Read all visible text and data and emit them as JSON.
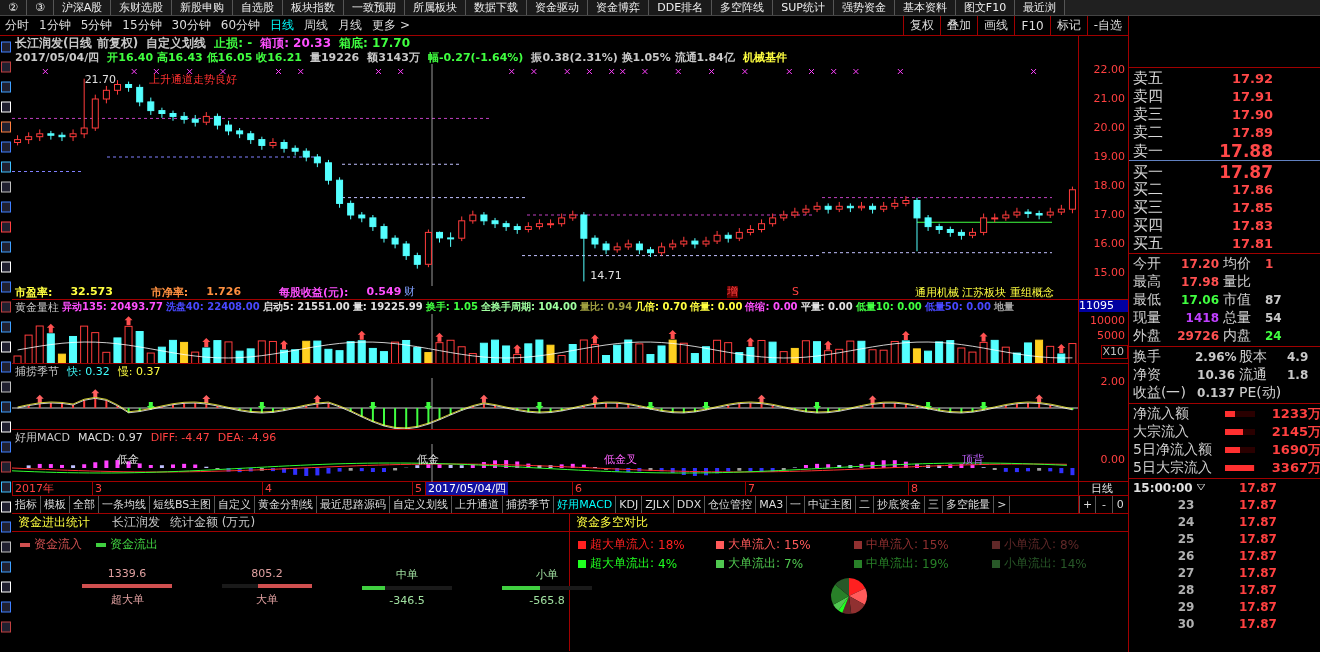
{
  "top_menu": [
    "②",
    "③",
    "沪深A股",
    "东财选股",
    "新股申购",
    "自选股",
    "板块指数",
    "一致预期",
    "所属板块",
    "数据下载",
    "资金驱动",
    "资金博弈",
    "DDE排名",
    "多空阵线",
    "SUP统计",
    "强势资金",
    "基本资料",
    "图文F10",
    "最近浏"
  ],
  "period_tabs": [
    {
      "label": "分时",
      "selected": false
    },
    {
      "label": "1分钟",
      "selected": false
    },
    {
      "label": "5分钟",
      "selected": false
    },
    {
      "label": "15分钟",
      "selected": false
    },
    {
      "label": "30分钟",
      "selected": false
    },
    {
      "label": "60分钟",
      "selected": false
    },
    {
      "label": "日线",
      "selected": true
    },
    {
      "label": "周线",
      "selected": false
    },
    {
      "label": "月线",
      "selected": false
    },
    {
      "label": "更多 >",
      "selected": false
    }
  ],
  "chart_tools": [
    "复权",
    "叠加",
    "画线",
    "F10",
    "标记",
    "-自选"
  ],
  "price_panel": {
    "header": [
      {
        "text": "长江润发(日线 前复权)",
        "color": "#c8c8c8"
      },
      {
        "text": "自定义划线",
        "color": "#c8c8c8"
      },
      {
        "text": "止损: -",
        "color": "#40ff40"
      },
      {
        "text": "箱顶: 20.33",
        "color": "#ff50ff"
      },
      {
        "text": "箱底: 17.70",
        "color": "#40ff40"
      }
    ],
    "quote": [
      {
        "text": "2017/05/04/四",
        "color": "#c8c8c8"
      },
      {
        "text": "开16.40 高16.43 低16.05 收16.21",
        "color": "#40ff40"
      },
      {
        "text": "量19226",
        "color": "#c8c8c8"
      },
      {
        "text": "额3143万",
        "color": "#c8c8c8"
      },
      {
        "text": "幅-0.27(-1.64%)",
        "color": "#40ff40"
      },
      {
        "text": "振0.38(2.31%) 换1.05% 流通1.84亿",
        "color": "#c8c8c8"
      },
      {
        "text": "机械基件",
        "color": "#ffff40"
      }
    ],
    "axis": [
      "22.00",
      "21.00",
      "20.00",
      "19.00",
      "18.00",
      "17.00",
      "16.00",
      "15.00"
    ],
    "annotations": [
      "21.70",
      "上升通道走势良好",
      "14.71"
    ],
    "valuation": [
      {
        "label": "市盈率:",
        "value": "32.573",
        "color": "#ffff40"
      },
      {
        "label": "市净率:",
        "value": "1.726",
        "color": "#ff9040"
      },
      {
        "label": "每股收益(元):",
        "value": "0.549",
        "color": "#ff50ff"
      }
    ],
    "event_marks": [
      "财",
      "增",
      "S"
    ],
    "concepts": "通用机械 江苏板块 重组概念",
    "chart_data": {
      "type": "candlestick",
      "ohlc": [
        [
          19.5,
          19.75,
          19.4,
          19.6
        ],
        [
          19.6,
          19.85,
          19.45,
          19.7
        ],
        [
          19.7,
          19.95,
          19.55,
          19.8
        ],
        [
          19.8,
          19.9,
          19.6,
          19.75
        ],
        [
          19.75,
          19.85,
          19.55,
          19.7
        ],
        [
          19.7,
          19.95,
          19.55,
          19.8
        ],
        [
          19.8,
          21.7,
          19.65,
          20.0
        ],
        [
          20.0,
          21.15,
          19.9,
          21.0
        ],
        [
          21.0,
          21.45,
          20.85,
          21.3
        ],
        [
          21.3,
          21.65,
          21.15,
          21.5
        ],
        [
          21.5,
          21.6,
          21.25,
          21.4
        ],
        [
          21.4,
          21.5,
          20.75,
          20.9
        ],
        [
          20.9,
          21.05,
          20.45,
          20.6
        ],
        [
          20.6,
          20.7,
          20.35,
          20.5
        ],
        [
          20.5,
          20.6,
          20.25,
          20.4
        ],
        [
          20.4,
          20.55,
          20.15,
          20.3
        ],
        [
          20.3,
          20.45,
          20.05,
          20.2
        ],
        [
          20.2,
          20.55,
          20.1,
          20.4
        ],
        [
          20.4,
          20.5,
          19.95,
          20.1
        ],
        [
          20.1,
          20.25,
          19.75,
          19.9
        ],
        [
          19.9,
          20.0,
          19.65,
          19.8
        ],
        [
          19.8,
          19.9,
          19.45,
          19.6
        ],
        [
          19.6,
          19.7,
          19.25,
          19.4
        ],
        [
          19.4,
          19.65,
          19.3,
          19.5
        ],
        [
          19.5,
          19.6,
          19.15,
          19.3
        ],
        [
          19.3,
          19.4,
          19.05,
          19.2
        ],
        [
          19.2,
          19.3,
          18.85,
          19.0
        ],
        [
          19.0,
          19.1,
          18.65,
          18.8
        ],
        [
          18.8,
          18.9,
          18.05,
          18.2
        ],
        [
          18.2,
          18.3,
          17.25,
          17.4
        ],
        [
          17.4,
          17.5,
          16.85,
          17.0
        ],
        [
          17.0,
          17.1,
          16.75,
          16.9
        ],
        [
          16.9,
          17.0,
          16.45,
          16.6
        ],
        [
          16.6,
          16.7,
          16.05,
          16.2
        ],
        [
          16.2,
          16.3,
          15.85,
          16.0
        ],
        [
          16.0,
          16.1,
          15.45,
          15.6
        ],
        [
          15.6,
          15.7,
          15.15,
          15.3
        ],
        [
          15.3,
          16.5,
          15.2,
          16.4
        ],
        [
          16.4,
          16.43,
          16.05,
          16.21
        ],
        [
          16.21,
          16.4,
          15.9,
          16.2
        ],
        [
          16.2,
          16.95,
          16.1,
          16.8
        ],
        [
          16.8,
          17.15,
          16.7,
          17.0
        ],
        [
          17.0,
          17.1,
          16.65,
          16.8
        ],
        [
          16.8,
          16.9,
          16.55,
          16.7
        ],
        [
          16.7,
          16.8,
          16.45,
          16.6
        ],
        [
          16.6,
          16.7,
          16.35,
          16.5
        ],
        [
          16.5,
          16.75,
          16.4,
          16.6
        ],
        [
          16.6,
          16.85,
          16.5,
          16.7
        ],
        [
          16.7,
          16.85,
          16.55,
          16.7
        ],
        [
          16.7,
          17.05,
          16.6,
          16.9
        ],
        [
          16.9,
          17.15,
          16.8,
          17.0
        ],
        [
          17.0,
          17.1,
          14.71,
          16.2
        ],
        [
          16.2,
          16.3,
          15.85,
          16.0
        ],
        [
          16.0,
          16.1,
          15.65,
          15.8
        ],
        [
          15.8,
          16.05,
          15.7,
          15.9
        ],
        [
          15.9,
          16.15,
          15.8,
          16.0
        ],
        [
          16.0,
          16.1,
          15.65,
          15.8
        ],
        [
          15.8,
          15.9,
          15.55,
          15.7
        ],
        [
          15.7,
          16.05,
          15.6,
          15.9
        ],
        [
          15.9,
          16.15,
          15.8,
          16.0
        ],
        [
          16.0,
          16.25,
          15.9,
          16.1
        ],
        [
          16.1,
          16.2,
          15.85,
          16.0
        ],
        [
          16.0,
          16.25,
          15.9,
          16.1
        ],
        [
          16.1,
          16.45,
          16.0,
          16.3
        ],
        [
          16.3,
          16.4,
          16.05,
          16.2
        ],
        [
          16.2,
          16.55,
          16.1,
          16.4
        ],
        [
          16.4,
          16.65,
          16.3,
          16.5
        ],
        [
          16.5,
          16.85,
          16.4,
          16.7
        ],
        [
          16.7,
          17.05,
          16.6,
          16.9
        ],
        [
          16.9,
          17.15,
          16.8,
          17.0
        ],
        [
          17.0,
          17.25,
          16.9,
          17.1
        ],
        [
          17.1,
          17.35,
          17.0,
          17.2
        ],
        [
          17.2,
          17.45,
          17.1,
          17.3
        ],
        [
          17.3,
          17.4,
          17.05,
          17.2
        ],
        [
          17.2,
          17.45,
          17.1,
          17.3
        ],
        [
          17.3,
          17.4,
          17.1,
          17.25
        ],
        [
          17.25,
          17.45,
          17.15,
          17.3
        ],
        [
          17.3,
          17.4,
          17.05,
          17.2
        ],
        [
          17.2,
          17.45,
          17.1,
          17.3
        ],
        [
          17.3,
          17.55,
          17.2,
          17.4
        ],
        [
          17.4,
          17.65,
          17.3,
          17.5
        ],
        [
          17.5,
          17.6,
          15.75,
          16.9
        ],
        [
          16.9,
          17.0,
          16.45,
          16.6
        ],
        [
          16.6,
          16.7,
          16.35,
          16.5
        ],
        [
          16.5,
          16.6,
          16.25,
          16.4
        ],
        [
          16.4,
          16.5,
          16.15,
          16.3
        ],
        [
          16.3,
          16.55,
          16.2,
          16.4
        ],
        [
          16.4,
          17.05,
          16.3,
          16.9
        ],
        [
          16.9,
          17.05,
          16.75,
          16.9
        ],
        [
          16.9,
          17.15,
          16.8,
          17.0
        ],
        [
          17.0,
          17.25,
          16.9,
          17.1
        ],
        [
          17.1,
          17.2,
          16.9,
          17.05
        ],
        [
          17.05,
          17.15,
          16.85,
          17.0
        ],
        [
          17.0,
          17.25,
          16.9,
          17.1
        ],
        [
          17.1,
          17.35,
          17.0,
          17.2
        ],
        [
          17.2,
          17.98,
          17.06,
          17.87
        ]
      ]
    }
  },
  "volume_panel": {
    "title": "黄金量柱",
    "values": [
      {
        "text": "异动135: 20493.77",
        "color": "#ff50ff"
      },
      {
        "text": "洗盘40: 22408.00",
        "color": "#4848ff"
      },
      {
        "text": "启动5: 21551.00",
        "color": "#e0e0e0"
      },
      {
        "text": "量: 19225.99",
        "color": "#e0e0e0"
      },
      {
        "text": "换手: 1.05",
        "color": "#40ff40"
      },
      {
        "text": "全换手周期: 104.00",
        "color": "#a0ffa0"
      },
      {
        "text": "量比: 0.94",
        "color": "#a0a040"
      },
      {
        "text": "几倍: 0.70",
        "color": "#ffff40"
      },
      {
        "text": "倍量: 0.00",
        "color": "#ffff40"
      },
      {
        "text": "倍缩: 0.00",
        "color": "#ff50ff"
      },
      {
        "text": "平量: 0.00",
        "color": "#e0e0e0"
      },
      {
        "text": "低量10: 0.00",
        "color": "#40ff40"
      },
      {
        "text": "低量50: 0.00",
        "color": "#4848ff"
      },
      {
        "text": "地量",
        "color": "#a0a0a0"
      }
    ],
    "axis": [
      "11095",
      "10000",
      "5000",
      "X10"
    ]
  },
  "capture_panel": {
    "title": "捕捞季节",
    "values": [
      {
        "text": "快: 0.32",
        "color": "#40ffff"
      },
      {
        "text": "慢: 0.37",
        "color": "#ffff40"
      }
    ],
    "axis": [
      "2.00"
    ]
  },
  "macd_panel": {
    "title": "好用MACD",
    "values": [
      {
        "text": "MACD: 0.97",
        "color": "#e0e0e0"
      },
      {
        "text": "DIFF: -4.47",
        "color": "#ff4040"
      },
      {
        "text": "DEA: -4.96",
        "color": "#ff4040"
      }
    ],
    "signals": [
      "低金",
      "低金",
      "低金叉",
      "顶背"
    ],
    "axis": [
      "0.00"
    ]
  },
  "date_axis": {
    "labels": [
      "2017年",
      "3",
      "4",
      "5",
      "6",
      "7",
      "8"
    ],
    "cursor": "2017/05/04/四",
    "period": "日线"
  },
  "indicator_tabs": [
    {
      "label": "指标",
      "selected": false
    },
    {
      "label": "模板",
      "selected": false
    },
    {
      "label": "全部",
      "selected": false
    },
    {
      "label": "一条均线",
      "selected": false
    },
    {
      "label": "短线BS主图",
      "selected": false
    },
    {
      "label": "自定义",
      "selected": false
    },
    {
      "label": "黄金分割线",
      "selected": false
    },
    {
      "label": "最近思路源码",
      "selected": false
    },
    {
      "label": "自定义划线",
      "selected": false
    },
    {
      "label": "上升通道",
      "selected": false
    },
    {
      "label": "捕捞季节",
      "selected": false
    },
    {
      "label": "好用MACD",
      "selected": true
    },
    {
      "label": "KDJ",
      "selected": false
    },
    {
      "label": "ZJLX",
      "selected": false
    },
    {
      "label": "DDX",
      "selected": false
    },
    {
      "label": "仓位管控",
      "selected": false
    },
    {
      "label": "MA3",
      "selected": false
    },
    {
      "label": "一",
      "selected": false
    },
    {
      "label": "中证主图",
      "selected": false
    },
    {
      "label": "二",
      "selected": false
    },
    {
      "label": "抄底资金",
      "selected": false
    },
    {
      "label": "三",
      "selected": false
    },
    {
      "label": "多空能量",
      "selected": false
    },
    {
      "label": ">",
      "selected": false
    }
  ],
  "zoom_buttons": [
    "+",
    "-",
    "0"
  ],
  "fund_stats": {
    "title": "资金进出统计",
    "stock": "长江润发",
    "unit": "统计金额 (万元)",
    "legend": [
      {
        "label": "资金流入",
        "color": "#d05050"
      },
      {
        "label": "资金流出",
        "color": "#40d040"
      }
    ],
    "groups": [
      {
        "label": "超大单",
        "value": "1339.6",
        "kind": "inflow",
        "level": 1.0
      },
      {
        "label": "大单",
        "value": "805.2",
        "kind": "inflow",
        "level": 0.6
      },
      {
        "label": "中单",
        "value": "-346.5",
        "kind": "outflow",
        "level": 0.26
      },
      {
        "label": "小单",
        "value": "-565.8",
        "kind": "outflow",
        "level": 0.42
      }
    ]
  },
  "fund_compare": {
    "title": "资金多空对比",
    "items": [
      {
        "label": "超大单流入:",
        "value": "18%",
        "color": "#ff2020"
      },
      {
        "label": "大单流入:",
        "value": "15%",
        "color": "#ff5a5a"
      },
      {
        "label": "中单流入:",
        "value": "15%",
        "color": "#903030"
      },
      {
        "label": "小单流入:",
        "value": "8%",
        "color": "#602828"
      },
      {
        "label": "超大单流出:",
        "value": "4%",
        "color": "#20ff20"
      },
      {
        "label": "大单流出:",
        "value": "7%",
        "color": "#50c850"
      },
      {
        "label": "中单流出:",
        "value": "19%",
        "color": "#288028"
      },
      {
        "label": "小单流出:",
        "value": "14%",
        "color": "#285828"
      }
    ],
    "chart_data": {
      "type": "pie",
      "values": [
        18,
        15,
        15,
        8,
        4,
        7,
        19,
        14
      ]
    }
  },
  "quote_panel": {
    "sell": [
      {
        "label": "卖五",
        "price": "17.92",
        "large": false
      },
      {
        "label": "卖四",
        "price": "17.91",
        "large": false
      },
      {
        "label": "卖三",
        "price": "17.90",
        "large": false
      },
      {
        "label": "卖二",
        "price": "17.89",
        "large": false
      },
      {
        "label": "卖一",
        "price": "17.88",
        "large": true
      }
    ],
    "buy": [
      {
        "label": "买一",
        "price": "17.87",
        "large": true
      },
      {
        "label": "买二",
        "price": "17.86",
        "large": false
      },
      {
        "label": "买三",
        "price": "17.85",
        "large": false
      },
      {
        "label": "买四",
        "price": "17.83",
        "large": false
      },
      {
        "label": "买五",
        "price": "17.81",
        "large": false
      }
    ],
    "stats": [
      [
        {
          "label": "今开",
          "value": "17.20",
          "color": "#ff5050"
        },
        {
          "label": "均价",
          "value": "1",
          "color": "#ff5050"
        }
      ],
      [
        {
          "label": "最高",
          "value": "17.98",
          "color": "#ff5050"
        },
        {
          "label": "量比"
        }
      ],
      [
        {
          "label": "最低",
          "value": "17.06",
          "color": "#40ff40"
        },
        {
          "label": "市值",
          "value": "87",
          "color": "#c8c8c8"
        }
      ],
      [
        {
          "label": "现量",
          "value": "1418",
          "color": "#c040ff"
        },
        {
          "label": "总量",
          "value": "54",
          "color": "#c8c8c8"
        }
      ],
      [
        {
          "label": "外盘",
          "value": "29726",
          "color": "#ff5050"
        },
        {
          "label": "内盘",
          "value": "24",
          "color": "#40ff40"
        }
      ]
    ],
    "fundamentals": [
      [
        {
          "label": "换手",
          "value": "2.96%",
          "color": "#c8c8c8"
        },
        {
          "label": "股本",
          "value": "4.9",
          "color": "#c8c8c8"
        }
      ],
      [
        {
          "label": "净资",
          "value": "10.36",
          "color": "#c8c8c8"
        },
        {
          "label": "流通",
          "value": "1.8",
          "color": "#c8c8c8"
        }
      ],
      [
        {
          "label": "收益(一)",
          "value": "0.137",
          "color": "#c8c8c8"
        },
        {
          "label": "PE(动)"
        }
      ]
    ],
    "flows": [
      {
        "label": "净流入额",
        "level": 0.33,
        "value": "1233万"
      },
      {
        "label": "大宗流入",
        "level": 0.6,
        "value": "2145万"
      },
      {
        "label": "5日净流入额",
        "level": 0.5,
        "value": "1690万"
      },
      {
        "label": "5日大宗流入",
        "level": 0.95,
        "value": "3367万"
      }
    ],
    "ticks": [
      {
        "time": "15:00:00",
        "price": "17.87"
      },
      {
        "time": "23",
        "price": "17.87"
      },
      {
        "time": "24",
        "price": "17.87"
      },
      {
        "time": "25",
        "price": "17.87"
      },
      {
        "time": "26",
        "price": "17.87"
      },
      {
        "time": "27",
        "price": "17.87"
      },
      {
        "time": "28",
        "price": "17.87"
      },
      {
        "time": "29",
        "price": "17.87"
      },
      {
        "time": "30",
        "price": "17.87"
      }
    ]
  }
}
